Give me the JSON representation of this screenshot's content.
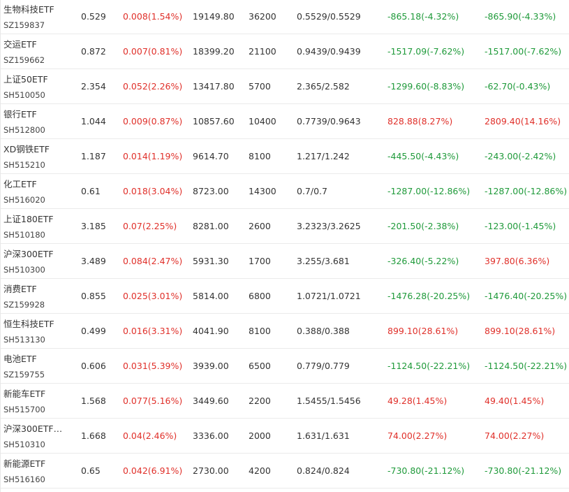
{
  "colors": {
    "up": "#e0302a",
    "down": "#1f9a3a",
    "text": "#333333",
    "divider": "#ebebeb"
  },
  "rows": [
    {
      "name": "生物科技ETF",
      "code": "SZ159837",
      "price": "0.529",
      "change": "0.008(1.54%)",
      "change_dir": "up",
      "amount": "19149.80",
      "qty": "36200",
      "cost": "0.5529/0.5529",
      "pnl1": "-865.18(-4.32%)",
      "pnl1_dir": "down",
      "pnl2": "-865.90(-4.33%)",
      "pnl2_dir": "down"
    },
    {
      "name": "交运ETF",
      "code": "SZ159662",
      "price": "0.872",
      "change": "0.007(0.81%)",
      "change_dir": "up",
      "amount": "18399.20",
      "qty": "21100",
      "cost": "0.9439/0.9439",
      "pnl1": "-1517.09(-7.62%)",
      "pnl1_dir": "down",
      "pnl2": "-1517.00(-7.62%)",
      "pnl2_dir": "down"
    },
    {
      "name": "上证50ETF",
      "code": "SH510050",
      "price": "2.354",
      "change": "0.052(2.26%)",
      "change_dir": "up",
      "amount": "13417.80",
      "qty": "5700",
      "cost": "2.365/2.582",
      "pnl1": "-1299.60(-8.83%)",
      "pnl1_dir": "down",
      "pnl2": "-62.70(-0.43%)",
      "pnl2_dir": "down"
    },
    {
      "name": "银行ETF",
      "code": "SH512800",
      "price": "1.044",
      "change": "0.009(0.87%)",
      "change_dir": "up",
      "amount": "10857.60",
      "qty": "10400",
      "cost": "0.7739/0.9643",
      "pnl1": "828.88(8.27%)",
      "pnl1_dir": "up",
      "pnl2": "2809.40(14.16%)",
      "pnl2_dir": "up"
    },
    {
      "name": "XD钢铁ETF",
      "code": "SH515210",
      "price": "1.187",
      "change": "0.014(1.19%)",
      "change_dir": "up",
      "amount": "9614.70",
      "qty": "8100",
      "cost": "1.217/1.242",
      "pnl1": "-445.50(-4.43%)",
      "pnl1_dir": "down",
      "pnl2": "-243.00(-2.42%)",
      "pnl2_dir": "down"
    },
    {
      "name": "化工ETF",
      "code": "SH516020",
      "price": "0.61",
      "change": "0.018(3.04%)",
      "change_dir": "up",
      "amount": "8723.00",
      "qty": "14300",
      "cost": "0.7/0.7",
      "pnl1": "-1287.00(-12.86%)",
      "pnl1_dir": "down",
      "pnl2": "-1287.00(-12.86%)",
      "pnl2_dir": "down"
    },
    {
      "name": "上证180ETF",
      "code": "SH510180",
      "price": "3.185",
      "change": "0.07(2.25%)",
      "change_dir": "up",
      "amount": "8281.00",
      "qty": "2600",
      "cost": "3.2323/3.2625",
      "pnl1": "-201.50(-2.38%)",
      "pnl1_dir": "down",
      "pnl2": "-123.00(-1.45%)",
      "pnl2_dir": "down"
    },
    {
      "name": "沪深300ETF",
      "code": "SH510300",
      "price": "3.489",
      "change": "0.084(2.47%)",
      "change_dir": "up",
      "amount": "5931.30",
      "qty": "1700",
      "cost": "3.255/3.681",
      "pnl1": "-326.40(-5.22%)",
      "pnl1_dir": "down",
      "pnl2": "397.80(6.36%)",
      "pnl2_dir": "up"
    },
    {
      "name": "消费ETF",
      "code": "SZ159928",
      "price": "0.855",
      "change": "0.025(3.01%)",
      "change_dir": "up",
      "amount": "5814.00",
      "qty": "6800",
      "cost": "1.0721/1.0721",
      "pnl1": "-1476.28(-20.25%)",
      "pnl1_dir": "down",
      "pnl2": "-1476.40(-20.25%)",
      "pnl2_dir": "down"
    },
    {
      "name": "恒生科技ETF",
      "code": "SH513130",
      "price": "0.499",
      "change": "0.016(3.31%)",
      "change_dir": "up",
      "amount": "4041.90",
      "qty": "8100",
      "cost": "0.388/0.388",
      "pnl1": "899.10(28.61%)",
      "pnl1_dir": "up",
      "pnl2": "899.10(28.61%)",
      "pnl2_dir": "up"
    },
    {
      "name": "电池ETF",
      "code": "SZ159755",
      "price": "0.606",
      "change": "0.031(5.39%)",
      "change_dir": "up",
      "amount": "3939.00",
      "qty": "6500",
      "cost": "0.779/0.779",
      "pnl1": "-1124.50(-22.21%)",
      "pnl1_dir": "down",
      "pnl2": "-1124.50(-22.21%)",
      "pnl2_dir": "down"
    },
    {
      "name": "新能车ETF",
      "code": "SH515700",
      "price": "1.568",
      "change": "0.077(5.16%)",
      "change_dir": "up",
      "amount": "3449.60",
      "qty": "2200",
      "cost": "1.5455/1.5456",
      "pnl1": "49.28(1.45%)",
      "pnl1_dir": "up",
      "pnl2": "49.40(1.45%)",
      "pnl2_dir": "up"
    },
    {
      "name": "沪深300ETF…",
      "code": "SH510310",
      "price": "1.668",
      "change": "0.04(2.46%)",
      "change_dir": "up",
      "amount": "3336.00",
      "qty": "2000",
      "cost": "1.631/1.631",
      "pnl1": "74.00(2.27%)",
      "pnl1_dir": "up",
      "pnl2": "74.00(2.27%)",
      "pnl2_dir": "up"
    },
    {
      "name": "新能源ETF",
      "code": "SH516160",
      "price": "0.65",
      "change": "0.042(6.91%)",
      "change_dir": "up",
      "amount": "2730.00",
      "qty": "4200",
      "cost": "0.824/0.824",
      "pnl1": "-730.80(-21.12%)",
      "pnl1_dir": "down",
      "pnl2": "-730.80(-21.12%)",
      "pnl2_dir": "down"
    }
  ]
}
